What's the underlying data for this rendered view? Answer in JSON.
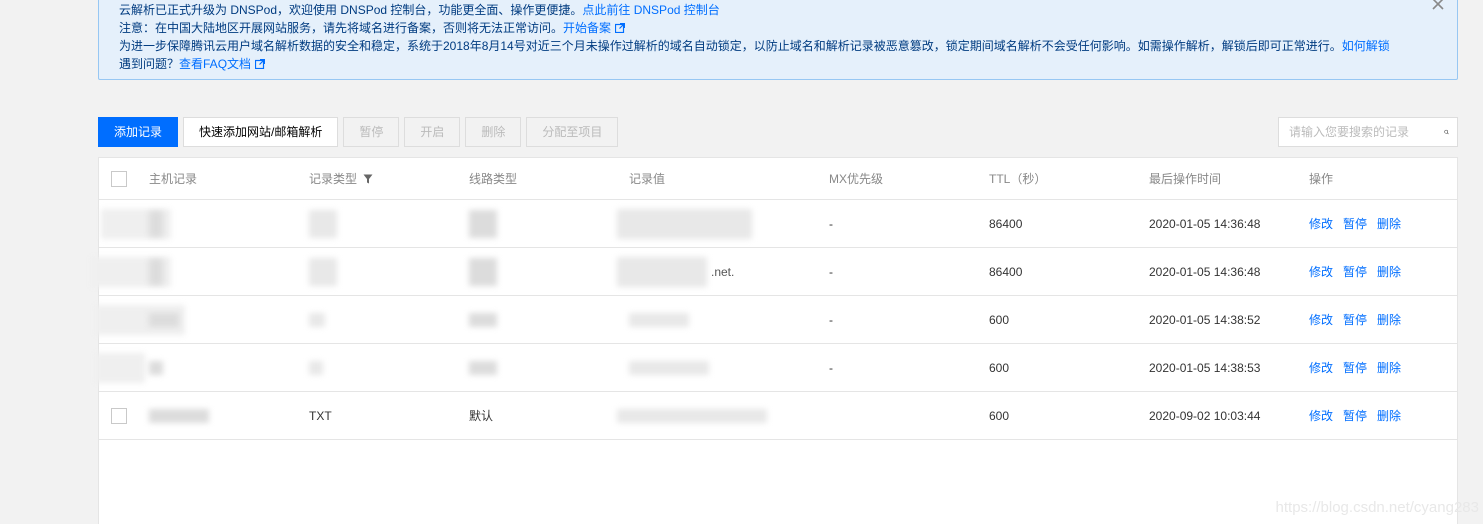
{
  "notice": {
    "line1_text": "云解析已正式升级为 DNSPod，欢迎使用 DNSPod 控制台，功能更全面、操作更便捷。",
    "line1_link": "点此前往 DNSPod 控制台",
    "line2_text": "注意：在中国大陆地区开展网站服务，请先将域名进行备案，否则将无法正常访问。",
    "line2_link": "开始备案",
    "line3_text": "为进一步保障腾讯云用户域名解析数据的安全和稳定，系统于2018年8月14号对近三个月未操作过解析的域名自动锁定，以防止域名和解析记录被恶意篡改，锁定期间域名解析不会受任何影响。如需操作解析，解锁后即可正常进行。",
    "line3_link1": "如何解锁",
    "line3_text2": "遇到问题？",
    "line3_link2": "查看FAQ文档"
  },
  "toolbar": {
    "add_record": "添加记录",
    "quick_add": "快速添加网站/邮箱解析",
    "pause": "暂停",
    "enable": "开启",
    "delete": "删除",
    "assign_project": "分配至项目"
  },
  "search": {
    "placeholder": "请输入您要搜索的记录"
  },
  "table": {
    "headers": {
      "host": "主机记录",
      "type": "记录类型",
      "line": "线路类型",
      "value": "记录值",
      "mx": "MX优先级",
      "ttl": "TTL（秒）",
      "time": "最后操作时间",
      "ops": "操作"
    },
    "ops_labels": {
      "edit": "修改",
      "pause": "暂停",
      "delete": "删除"
    },
    "rows": [
      {
        "type": "",
        "line": "",
        "value": "",
        "mx": "-",
        "ttl": "86400",
        "time": "2020-01-05 14:36:48"
      },
      {
        "type": "",
        "line": "",
        "value": ".net.",
        "mx": "-",
        "ttl": "86400",
        "time": "2020-01-05 14:36:48"
      },
      {
        "type": "",
        "line": "",
        "value": "",
        "mx": "-",
        "ttl": "600",
        "time": "2020-01-05 14:38:52"
      },
      {
        "type": "",
        "line": "",
        "value": "",
        "mx": "-",
        "ttl": "600",
        "time": "2020-01-05 14:38:53"
      },
      {
        "type": "TXT",
        "line": "默认",
        "value": "",
        "mx": "",
        "ttl": "600",
        "time": "2020-09-02 10:03:44"
      }
    ]
  },
  "watermark": "https://blog.csdn.net/cyang283",
  "colors": {
    "primary": "#006eff",
    "notice_bg": "#e5f0fb",
    "notice_border": "#97c7f3"
  }
}
